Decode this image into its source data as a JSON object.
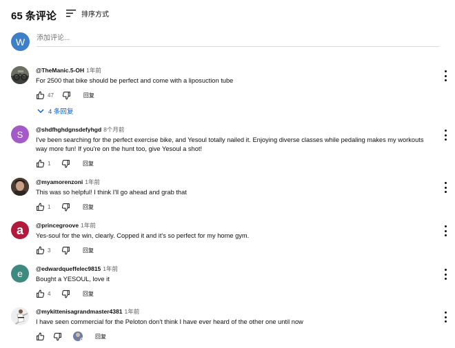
{
  "header": {
    "count_label": "65 条评论",
    "sort_label": "排序方式"
  },
  "add_comment": {
    "avatar_letter": "W",
    "placeholder": "添加评论..."
  },
  "colors": {
    "link_blue": "#065fd4",
    "avatar_w": "#3f7fc8",
    "avatar_s": "#a45ac7",
    "avatar_e": "#3f8a80"
  },
  "reply_label": "回复",
  "comments": [
    {
      "author": "@TheManic.5-OH",
      "time": "1年前",
      "text": "For 2500 that bike should be perfect and come with a liposuction tube",
      "likes": "47",
      "replies_label": "4 条回复",
      "avatar": "photo-bikes"
    },
    {
      "author": "@shdfhghdgnsdefyhgd",
      "time": "8个月前",
      "text": "I've been searching for the perfect exercise bike, and Yesoul totally nailed it. Enjoying diverse classes while pedaling makes my workouts way more fun! If you're on the hunt too, give Yesoul a shot!",
      "likes": "1",
      "avatar_letter": "S"
    },
    {
      "author": "@myamorenzoni",
      "time": "1年前",
      "text": "This was so helpful! I think I'll go ahead and grab that",
      "likes": "1",
      "avatar": "photo-person"
    },
    {
      "author": "@princegroove",
      "time": "1年前",
      "text": "Yes-soul for the win, clearly. Copped it and it's so perfect for my home gym.",
      "likes": "3",
      "avatar_letter": "a"
    },
    {
      "author": "@edwardqueffelec9815",
      "time": "1年前",
      "text": "Bought a YESOUL, love it",
      "likes": "4",
      "avatar_letter": "e"
    },
    {
      "author": "@mykittenisagrandmaster4381",
      "time": "1年前",
      "text": "I have seen commercial for the Peloton don't think I have ever heard of the other one until now",
      "likes": "",
      "avatar": "photo-martial"
    }
  ]
}
